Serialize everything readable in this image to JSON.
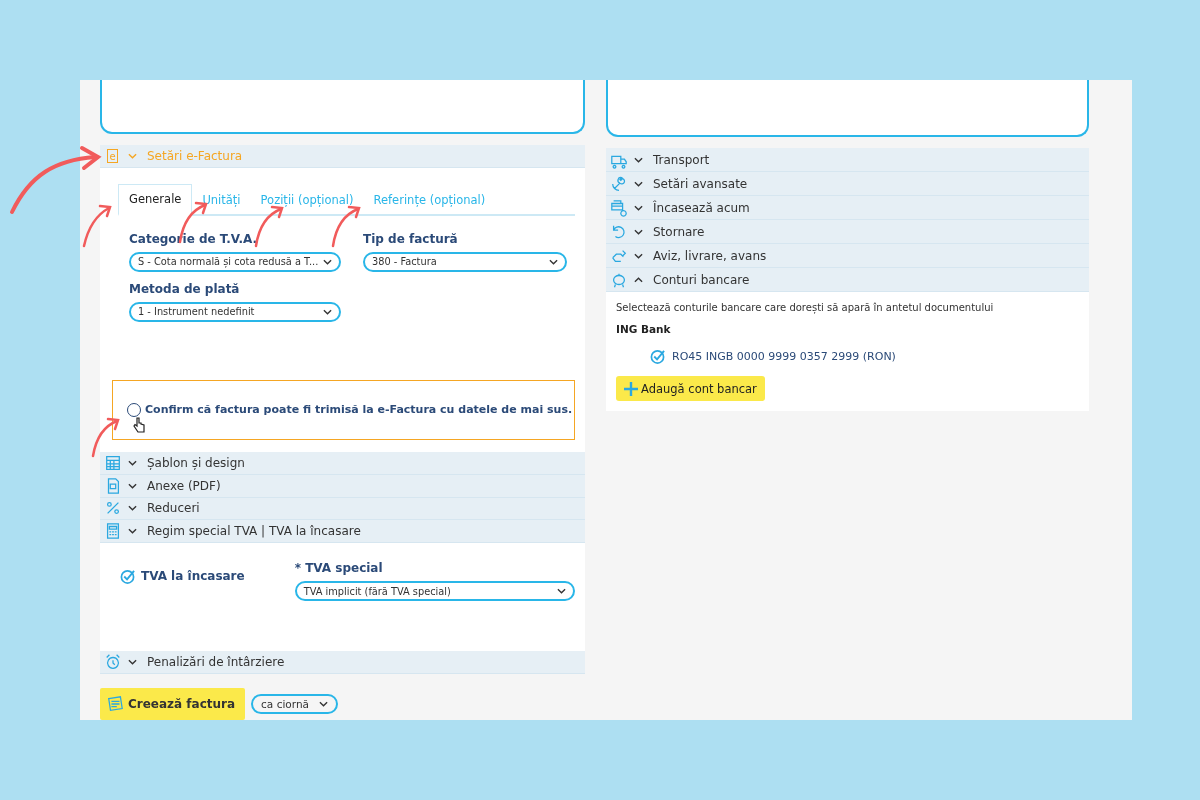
{
  "efactura": {
    "icon_letter": "e",
    "title": "Setări e-Factura",
    "expanded": true,
    "tabs": [
      {
        "label": "Generale",
        "selected": true
      },
      {
        "label": "Unități",
        "selected": false
      },
      {
        "label": "Poziții (opțional)",
        "selected": false
      },
      {
        "label": "Referințe (opțional)",
        "selected": false
      }
    ],
    "fields": [
      {
        "label": "Categorie de T.V.A.",
        "value": "S - Cota normală și cota redusă a T..."
      },
      {
        "label": "Tip de factură",
        "value": "380 - Factura"
      },
      {
        "label": "Metoda de plată",
        "value": "1 - Instrument nedefinit"
      }
    ],
    "confirm": {
      "label": "Confirm că factura poate fi trimisă la e-Factura cu datele de mai sus.",
      "checked": false
    }
  },
  "left_sections": [
    {
      "title": "Șablon și design",
      "kind": "template",
      "expanded": false
    },
    {
      "title": "Anexe (PDF)",
      "kind": "pdf",
      "expanded": false
    },
    {
      "title": "Reduceri",
      "kind": "discount",
      "expanded": false
    },
    {
      "title": "Regim special TVA | TVA la încasare",
      "kind": "vat",
      "expanded": true
    },
    {
      "title": "Penalizări de întârziere",
      "kind": "alarm",
      "expanded": false
    }
  ],
  "vat": {
    "checkbox": {
      "label": "TVA la încasare",
      "checked": true
    },
    "special": {
      "label": "* TVA special",
      "value": "TVA implicit (fără TVA special)"
    }
  },
  "create_button": "Creează factura",
  "save_mode": "ca ciornă",
  "right_sections": [
    {
      "title": "Transport",
      "kind": "truck",
      "expanded": false
    },
    {
      "title": "Setări avansate",
      "kind": "wrench",
      "expanded": false
    },
    {
      "title": "Încasează acum",
      "kind": "cash",
      "expanded": false
    },
    {
      "title": "Stornare",
      "kind": "undo",
      "expanded": false
    },
    {
      "title": "Aviz, livrare, avans",
      "kind": "delivery",
      "expanded": false
    },
    {
      "title": "Conturi bancare",
      "kind": "bank",
      "expanded": true
    }
  ],
  "bank": {
    "description": "Selectează conturile bancare care dorești să apară în antetul documentului",
    "bank_name": "ING Bank",
    "accounts": [
      {
        "label": "RO45 INGB 0000 9999 0357 2999 (RON)",
        "checked": true
      }
    ],
    "add_button": "Adaugă cont bancar"
  }
}
